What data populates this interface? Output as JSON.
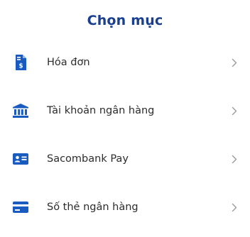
{
  "header": {
    "title": "Chọn mục"
  },
  "menu": {
    "items": [
      {
        "label": "Hóa đơn",
        "icon": "invoice-icon"
      },
      {
        "label": "Tài khoản ngân hàng",
        "icon": "bank-icon"
      },
      {
        "label": "Sacombank Pay",
        "icon": "id-card-icon"
      },
      {
        "label": "Số thẻ ngân hàng",
        "icon": "credit-card-icon"
      }
    ]
  },
  "colors": {
    "accent": "#1a5bbf",
    "title": "#1a3f8f",
    "chevron": "#9a9a9a"
  }
}
